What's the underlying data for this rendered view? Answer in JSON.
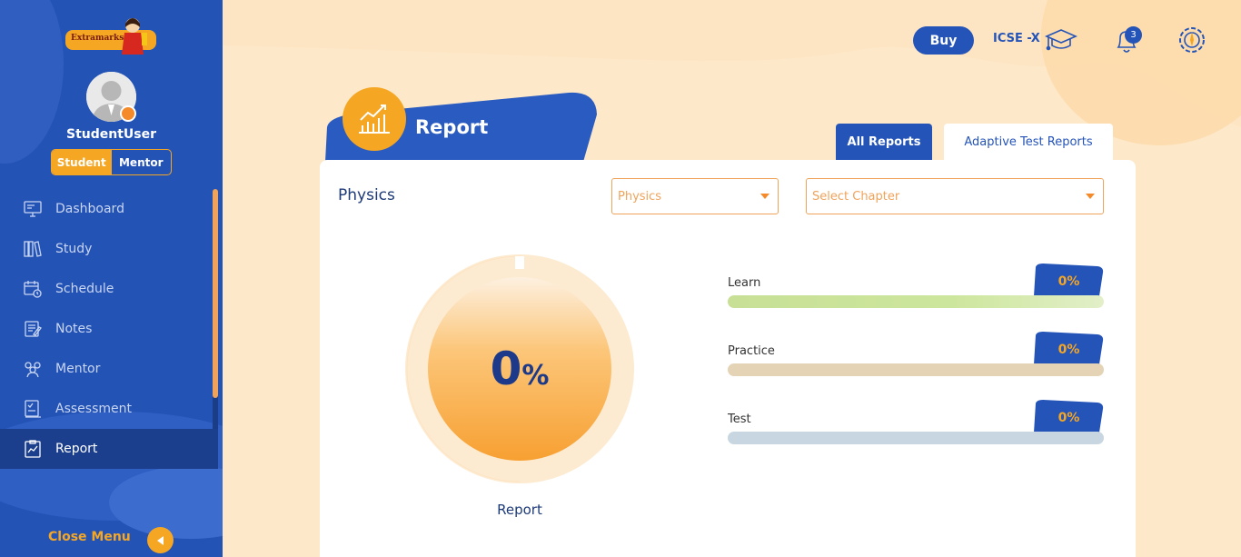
{
  "app": {
    "logo_text": "Extramarks",
    "username": "StudentUser",
    "roles": [
      "Student",
      "Mentor"
    ],
    "active_role": "Student"
  },
  "sidebar": {
    "items": [
      {
        "label": "Dashboard",
        "icon": "monitor-icon"
      },
      {
        "label": "Study",
        "icon": "books-icon"
      },
      {
        "label": "Schedule",
        "icon": "calendar-clock-icon"
      },
      {
        "label": "Notes",
        "icon": "notes-icon"
      },
      {
        "label": "Mentor",
        "icon": "group-icon"
      },
      {
        "label": "Assessment",
        "icon": "assessment-icon"
      },
      {
        "label": "Report",
        "icon": "report-icon",
        "active": true
      }
    ],
    "close_menu": "Close Menu"
  },
  "header": {
    "buy_label": "Buy",
    "grade": "ICSE -X",
    "notification_count": "3"
  },
  "report": {
    "title": "Report",
    "tabs": [
      "All Reports",
      "Adaptive Test Reports"
    ],
    "active_tab": "All Reports",
    "subject": "Physics",
    "subject_select": "Physics",
    "chapter_select_placeholder": "Select Chapter",
    "overall": {
      "value": "0",
      "unit": "%",
      "label": "Report"
    },
    "metrics": [
      {
        "label": "Learn",
        "value": "0%",
        "bar_color": "#c8e29a"
      },
      {
        "label": "Practice",
        "value": "0%",
        "bar_color": "#e4d3b5"
      },
      {
        "label": "Test",
        "value": "0%",
        "bar_color": "#c7d6e0"
      }
    ]
  },
  "colors": {
    "primary": "#2554b8",
    "accent": "#f5a623",
    "background": "#fde8c9"
  }
}
